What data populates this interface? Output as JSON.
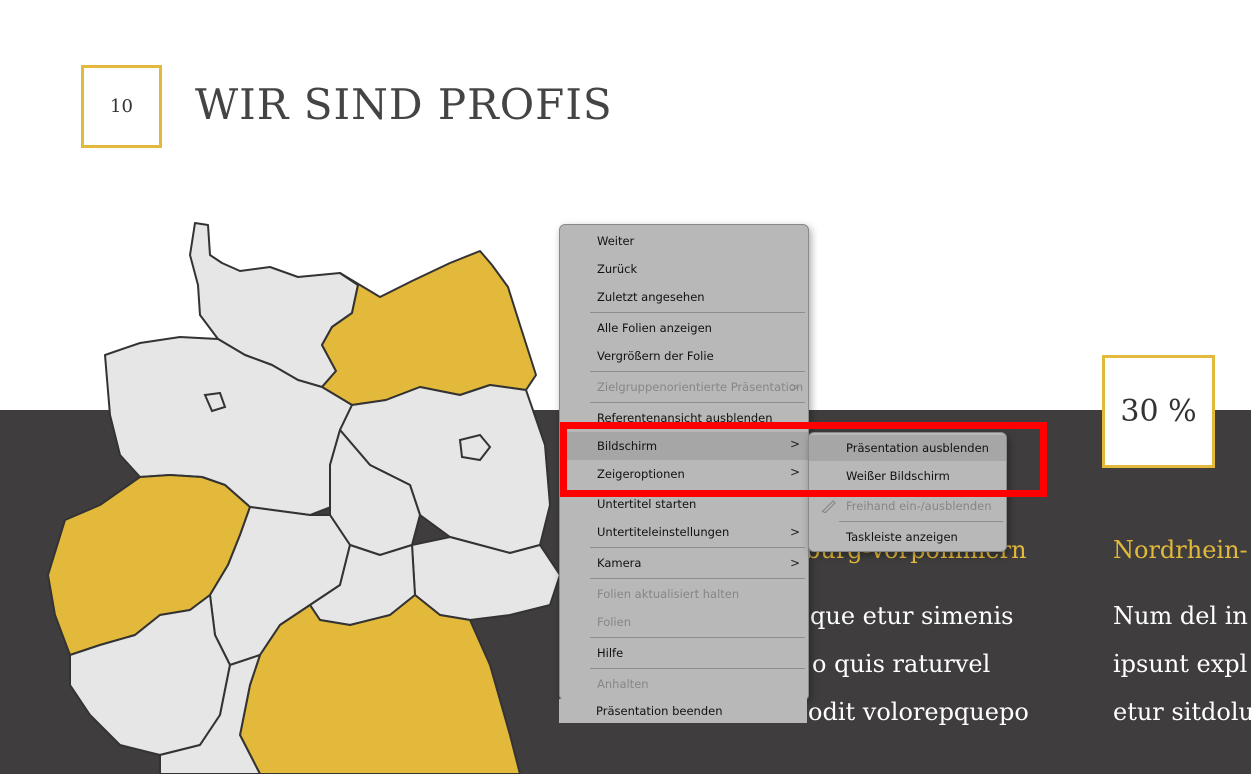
{
  "slide": {
    "number": "10",
    "title": "WIR SIND PROFIS",
    "percent": "30 %",
    "region_left_partial": "burg-Vorpommern",
    "region_right_partial": "Nordrhein-",
    "text_left": [
      "que etur simenis",
      "o quis raturvel",
      "odit volorepquepo"
    ],
    "text_right": [
      "Num del in",
      "ipsunt expl",
      "etur sitdolu"
    ]
  },
  "colors": {
    "accent": "#e2b93b",
    "dark_band": "#3f3d3d",
    "map_light": "#e6e6e6",
    "menu_bg": "#b8b8b8",
    "highlight_outline": "#ff0000"
  },
  "context_menu": {
    "items": [
      {
        "label": "Weiter",
        "disabled": false
      },
      {
        "label": "Zurück",
        "disabled": false
      },
      {
        "label": "Zuletzt angesehen",
        "disabled": false
      },
      {
        "label": "Alle Folien anzeigen",
        "disabled": false
      },
      {
        "label": "Vergrößern der Folie",
        "disabled": false
      },
      {
        "label": "Zielgruppenorientierte Präsentation",
        "disabled": true,
        "submenu": true
      },
      {
        "label": "Referentenansicht ausblenden",
        "disabled": false
      },
      {
        "label": "Bildschirm",
        "disabled": false,
        "submenu": true,
        "highlighted": true
      },
      {
        "label": "Zeigeroptionen",
        "disabled": false,
        "submenu": true
      },
      {
        "label": "Untertitel starten",
        "disabled": false
      },
      {
        "label": "Untertiteleinstellungen",
        "disabled": false,
        "submenu": true
      },
      {
        "label": "Kamera",
        "disabled": false,
        "submenu": true
      },
      {
        "label": "Folien aktualisiert halten",
        "disabled": true
      },
      {
        "label": "Folien",
        "disabled": true
      },
      {
        "label": "Hilfe",
        "disabled": false
      },
      {
        "label": "Anhalten",
        "disabled": true
      },
      {
        "label": "Präsentation beenden",
        "disabled": false
      }
    ],
    "submenu_glyph": ">"
  },
  "sub_menu": {
    "items": [
      {
        "label": "Präsentation ausblenden",
        "disabled": false,
        "highlighted": true
      },
      {
        "label": "Weißer Bildschirm",
        "disabled": false
      },
      {
        "label": "Freihand ein-/ausblenden",
        "disabled": true,
        "icon": "pen-icon"
      },
      {
        "label": "Taskleiste anzeigen",
        "disabled": false
      }
    ]
  }
}
